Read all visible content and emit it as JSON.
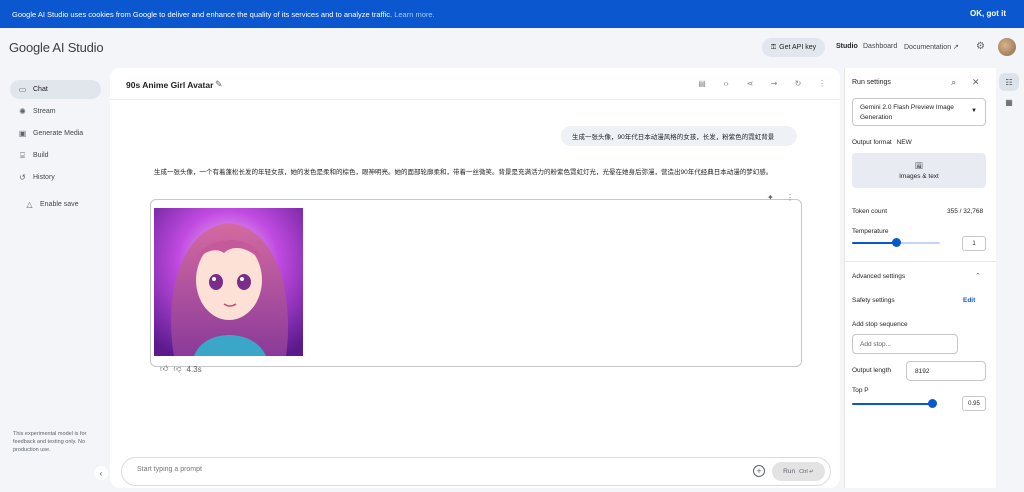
{
  "banner": {
    "message": "Google AI Studio uses cookies from Google to deliver and enhance the quality of its services and to analyze traffic.",
    "learn_more": "Learn more.",
    "ok": "OK, got it"
  },
  "header": {
    "logo": "Google AI Studio",
    "api_key": "Get API key",
    "studio": "Studio",
    "dashboard": "Dashboard",
    "documentation": "Documentation"
  },
  "sidebar": {
    "items": [
      {
        "label": "Chat",
        "icon": "chat-icon"
      },
      {
        "label": "Stream",
        "icon": "stream-icon"
      },
      {
        "label": "Generate Media",
        "icon": "media-icon"
      },
      {
        "label": "Build",
        "icon": "build-icon"
      },
      {
        "label": "History",
        "icon": "history-icon"
      },
      {
        "label": "Enable save",
        "icon": "drive-icon"
      }
    ],
    "note": "This experimental model is for feedback and testing only. No production use."
  },
  "chat": {
    "title": "90s Anime Girl Avatar",
    "user_message": "生成一张头像，90年代日本动漫风格的女孩，长发，粉紫色的霓虹背景",
    "model_text": "生成一张头像，一个有着蓬松长发的年轻女孩，她的发色是柔和的棕色，眼神明亮。她的面部轮廓柔和，带着一丝微笑。背景是充满活力的粉紫色霓虹灯光，光晕在她身后弥漫，营造出90年代经典日本动漫的梦幻感。",
    "response_time": "4.3s",
    "prompt_placeholder": "Start typing a prompt",
    "run_label": "Run",
    "run_shortcut": "Ctrl ↵"
  },
  "settings": {
    "title": "Run settings",
    "model": "Gemini 2.0 Flash Preview Image Generation",
    "output_format_label": "Output format",
    "output_format_badge": "NEW",
    "output_format_value": "Images & text",
    "token_count_label": "Token count",
    "token_count_value": "355 / 32,768",
    "temperature_label": "Temperature",
    "temperature_value": "1",
    "temperature_fraction": 0.5,
    "advanced_label": "Advanced settings",
    "safety_label": "Safety settings",
    "safety_edit": "Edit",
    "stop_sequence_label": "Add stop sequence",
    "stop_sequence_placeholder": "Add stop...",
    "output_length_label": "Output length",
    "output_length_value": "8192",
    "top_p_label": "Top P",
    "top_p_value": "0.95",
    "top_p_fraction": 0.95
  },
  "colors": {
    "accent": "#0b57d0",
    "banner": "#0b57d0"
  }
}
